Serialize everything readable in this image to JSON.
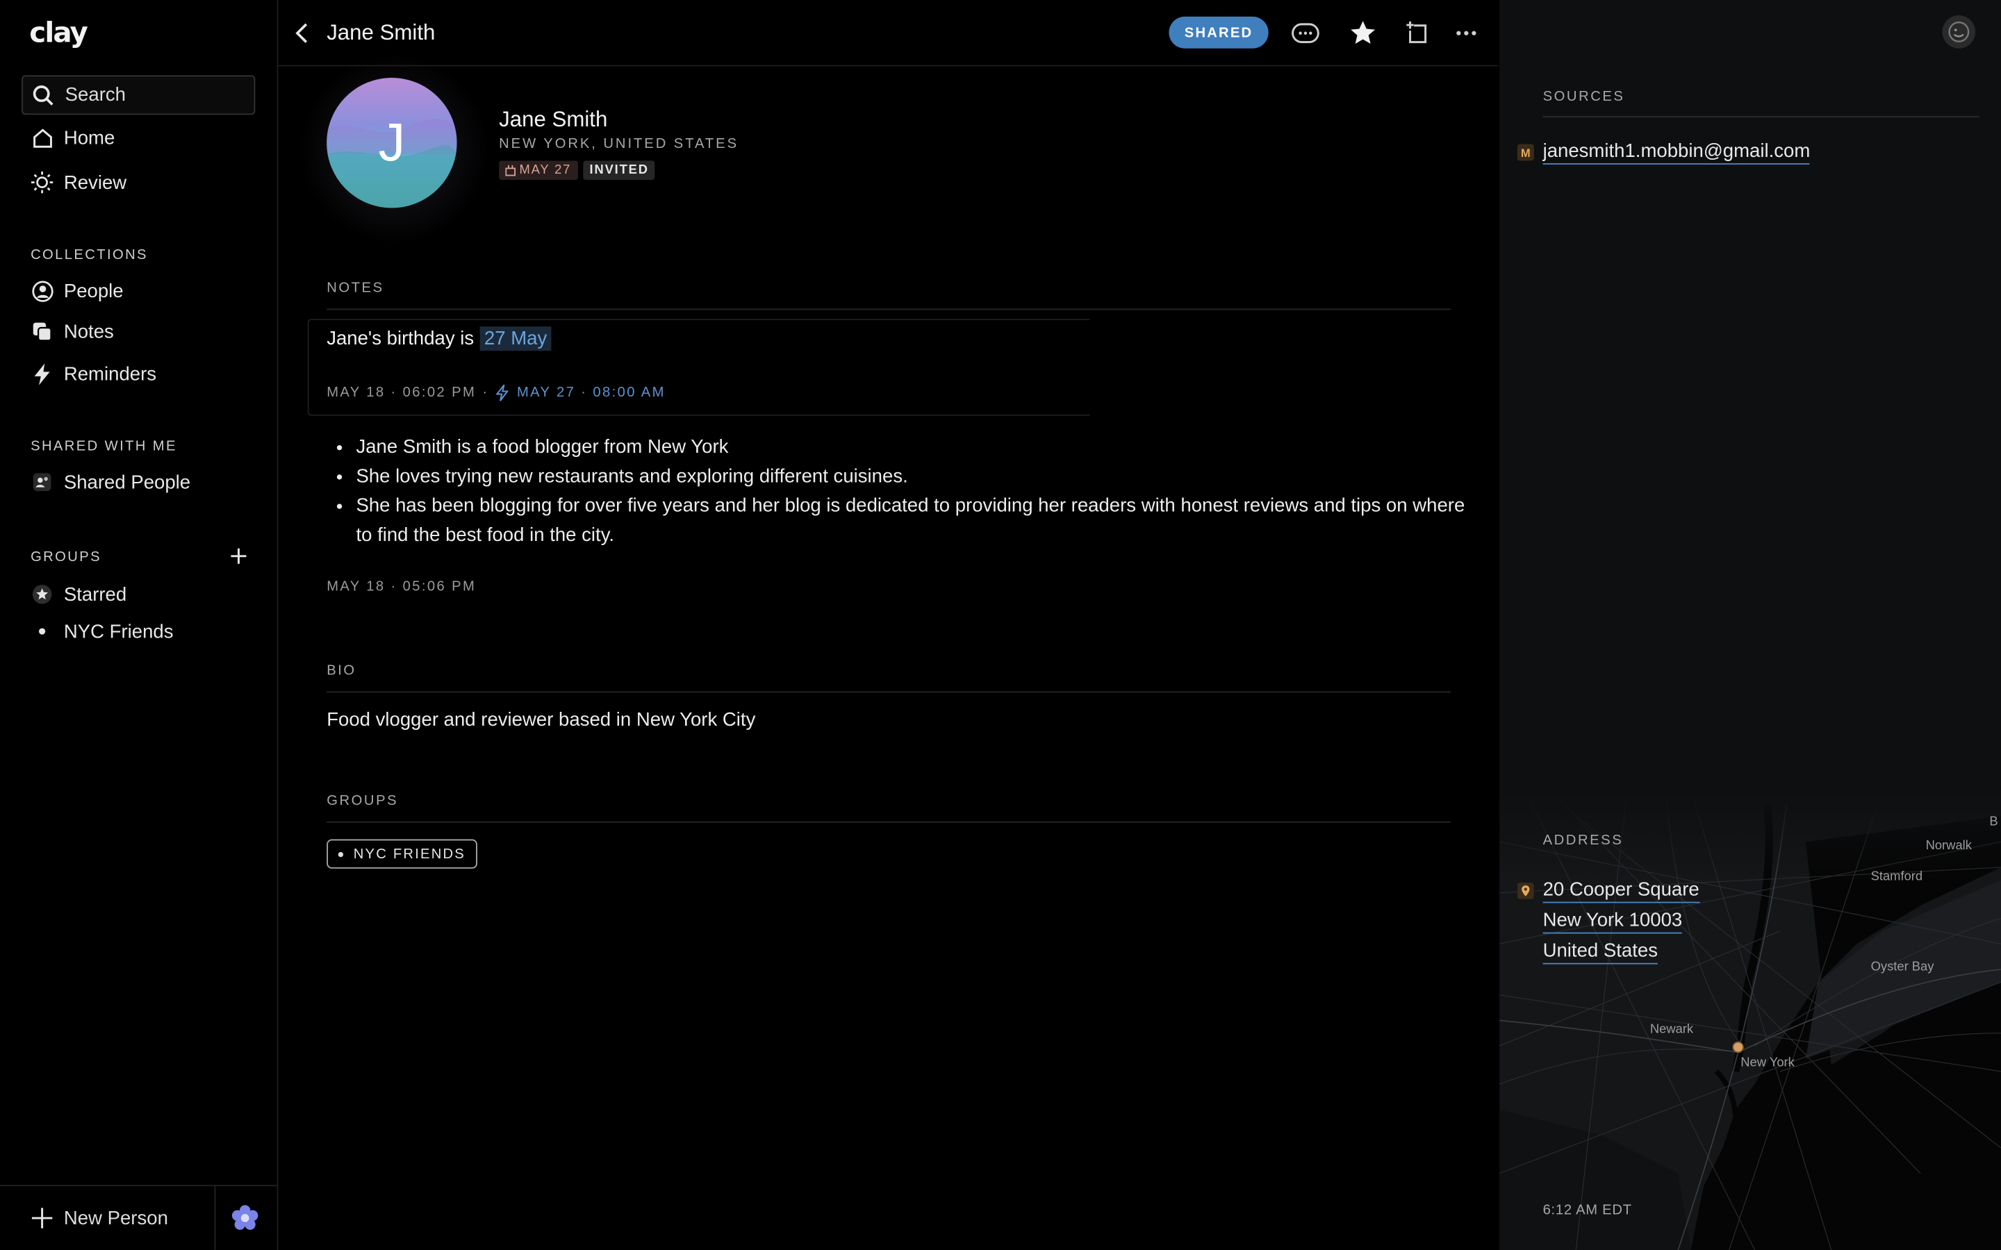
{
  "app": {
    "logo": "clay"
  },
  "sidebar": {
    "search_label": "Search",
    "nav": [
      {
        "label": "Home",
        "icon": "home-icon"
      },
      {
        "label": "Review",
        "icon": "sun-icon"
      }
    ],
    "collections_label": "COLLECTIONS",
    "collections": [
      {
        "label": "People",
        "icon": "person-circle-icon"
      },
      {
        "label": "Notes",
        "icon": "notes-icon"
      },
      {
        "label": "Reminders",
        "icon": "lightning-icon"
      }
    ],
    "shared_label": "SHARED WITH ME",
    "shared": [
      {
        "label": "Shared People",
        "icon": "shared-people-icon"
      }
    ],
    "groups_label": "GROUPS",
    "groups": [
      {
        "label": "Starred",
        "icon": "star-badge-icon"
      },
      {
        "label": "NYC Friends",
        "icon": "dot-icon"
      }
    ],
    "new_person_label": "New Person"
  },
  "header": {
    "title": "Jane Smith",
    "shared_badge": "SHARED"
  },
  "profile": {
    "avatar_initial": "J",
    "name": "Jane Smith",
    "location": "NEW YORK, UNITED STATES",
    "date_tag": "MAY 27",
    "status_tag": "INVITED"
  },
  "notes": {
    "label": "NOTES",
    "reminder_note": {
      "text": "Jane's birthday is",
      "highlight": "27 May",
      "created": "MAY 18 · 06:02 PM",
      "separator": "·",
      "reminder": "MAY 27 · 08:00 AM"
    },
    "bullets": [
      "Jane Smith is a food blogger from New York",
      "She loves trying new restaurants and exploring different cuisines.",
      "She has been blogging for over five years and her blog is dedicated to providing her readers with honest reviews and tips on where to find the best food in the city."
    ],
    "bullets_meta": "MAY 18 · 05:06 PM"
  },
  "bio": {
    "label": "BIO",
    "text": "Food vlogger and reviewer based in New York City"
  },
  "groups_section": {
    "label": "GROUPS",
    "chip": "NYC FRIENDS"
  },
  "right_panel": {
    "sources_label": "SOURCES",
    "source_badge": "M",
    "source_email": "janesmith1.mobbin@gmail.com",
    "address_label": "ADDRESS",
    "address_lines": [
      "20 Cooper Square",
      "New York 10003",
      "United States"
    ],
    "local_time": "6:12 AM EDT",
    "map_labels": [
      "B",
      "Norwalk",
      "Stamford",
      "Oyster Bay",
      "Newark",
      "New York"
    ]
  },
  "colors": {
    "accent": "#3f7fbe",
    "link_underline": "#4b86c5",
    "reminder": "#5d93d0"
  }
}
